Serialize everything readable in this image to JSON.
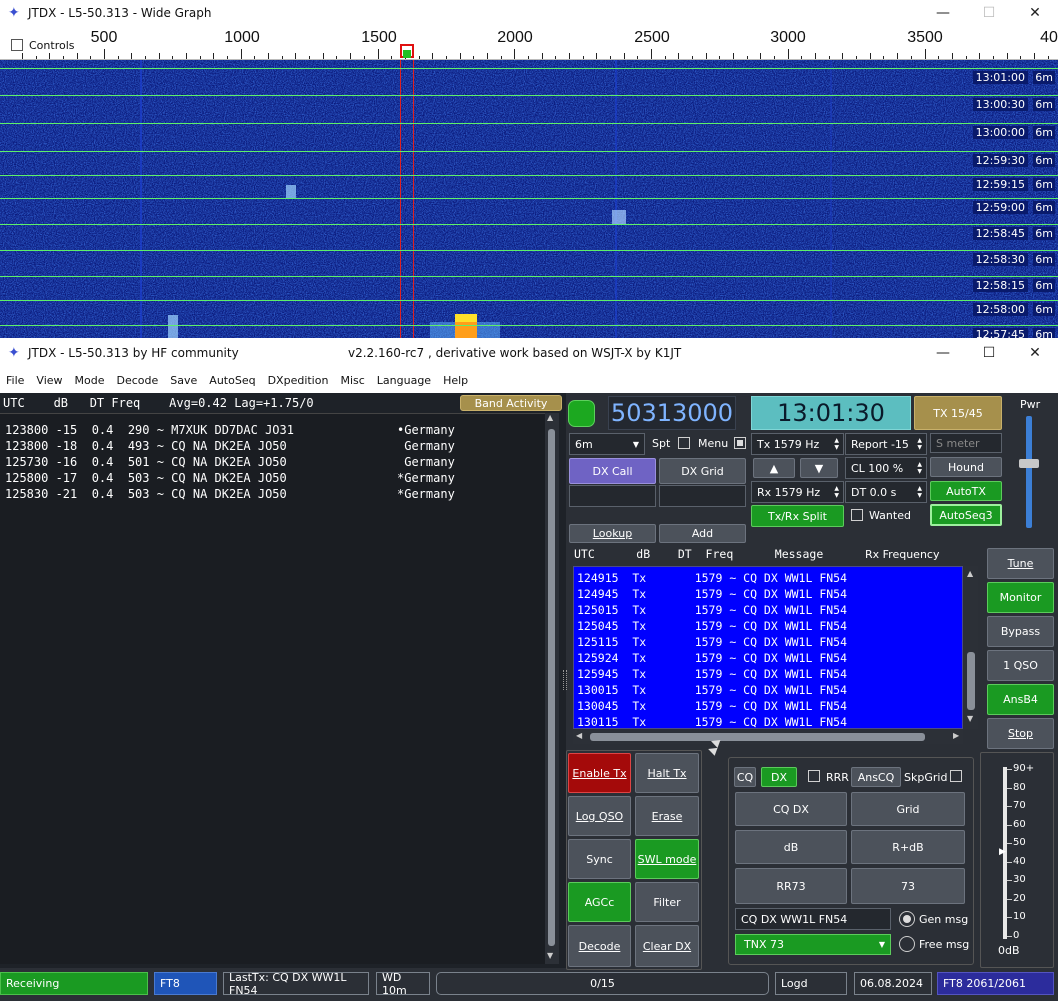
{
  "wide_graph": {
    "title": "JTDX - L5-50.313 - Wide Graph",
    "controls_label": "Controls",
    "scale_labels": [
      "500",
      "1000",
      "1500",
      "2000",
      "2500",
      "3000",
      "3500",
      "40"
    ],
    "time_rows": [
      {
        "time": "13:01:00",
        "band": "6m"
      },
      {
        "time": "13:00:30",
        "band": "6m"
      },
      {
        "time": "13:00:00",
        "band": "6m"
      },
      {
        "time": "12:59:30",
        "band": "6m"
      },
      {
        "time": "12:59:15",
        "band": "6m"
      },
      {
        "time": "12:59:00",
        "band": "6m"
      },
      {
        "time": "12:58:45",
        "band": "6m"
      },
      {
        "time": "12:58:30",
        "band": "6m"
      },
      {
        "time": "12:58:15",
        "band": "6m"
      },
      {
        "time": "12:58:00",
        "band": "6m"
      },
      {
        "time": "12:57:45",
        "band": "6m"
      }
    ]
  },
  "main": {
    "title": "JTDX - L5-50.313  by HF community",
    "title_right": "v2.2.160-rc7 , derivative work based on WSJT-X by K1JT",
    "menu": [
      "File",
      "View",
      "Mode",
      "Decode",
      "Save",
      "AutoSeq",
      "DXpedition",
      "Misc",
      "Language",
      "Help"
    ]
  },
  "band_activity": {
    "header": "UTC    dB   DT Freq    Avg=0.42 Lag=+1.75/0",
    "button": "Band Activity",
    "rows": [
      {
        "text": "123800 -15  0.4  290 ~ M7XUK DD7DAC JO31",
        "country": "•Germany"
      },
      {
        "text": "123800 -18  0.4  493 ~ CQ NA DK2EA JO50",
        "country": " Germany"
      },
      {
        "text": "125730 -16  0.4  501 ~ CQ NA DK2EA JO50",
        "country": " Germany"
      },
      {
        "text": "125800 -17  0.4  503 ~ CQ NA DK2EA JO50",
        "country": "*Germany"
      },
      {
        "text": "125830 -21  0.4  503 ~ CQ NA DK2EA JO50",
        "country": "*Germany"
      }
    ]
  },
  "controls": {
    "frequency": "50313000",
    "clock": "13:01:30",
    "tx_button": "TX 15/45",
    "pwr_label": "Pwr",
    "band": "6m",
    "spt": "Spt",
    "menu": "Menu",
    "tx_hz": "Tx  1579  Hz",
    "report": "Report -15",
    "smeter": "S meter",
    "dx_call": "DX Call",
    "dx_grid": "DX Grid",
    "cl": "CL  100 %",
    "hound": "Hound",
    "rx_hz": "Rx  1579  Hz",
    "dt": "DT  0.0 s",
    "autotx": "AutoTX",
    "txrx_split": "Tx/Rx Split",
    "wanted": "Wanted",
    "autoseq3": "AutoSeq3",
    "lookup": "Lookup",
    "add": "Add"
  },
  "rx_freq": {
    "header": "UTC      dB    DT  Freq      Message",
    "header_right": "Rx Frequency",
    "rows": [
      "124915  Tx       1579 ~ CQ DX WW1L FN54",
      "124945  Tx       1579 ~ CQ DX WW1L FN54",
      "125015  Tx       1579 ~ CQ DX WW1L FN54",
      "125045  Tx       1579 ~ CQ DX WW1L FN54",
      "125115  Tx       1579 ~ CQ DX WW1L FN54",
      "125924  Tx       1579 ~ CQ DX WW1L FN54",
      "125945  Tx       1579 ~ CQ DX WW1L FN54",
      "130015  Tx       1579 ~ CQ DX WW1L FN54",
      "130045  Tx       1579 ~ CQ DX WW1L FN54",
      "130115  Tx       1579 ~ CQ DX WW1L FN54"
    ]
  },
  "side_buttons": [
    "Tune",
    "Monitor",
    "Bypass",
    "1 QSO",
    "AnsB4",
    "Stop"
  ],
  "left_buttons": [
    "Enable Tx",
    "Halt Tx",
    "Log QSO",
    "Erase",
    "Sync",
    "SWL mode",
    "AGCc",
    "Filter",
    "Decode",
    "Clear DX"
  ],
  "msg_panel": {
    "cq": "CQ",
    "dx": "DX",
    "rrr": "RRR",
    "anscq": "AnsCQ",
    "skpgrid": "SkpGrid",
    "buttons": [
      "CQ DX",
      "Grid",
      "dB",
      "R+dB",
      "RR73",
      "73"
    ],
    "gen_text": "CQ DX WW1L FN54",
    "gen_label": "Gen msg",
    "free_text": "TNX 73",
    "free_label": "Free msg"
  },
  "meter": {
    "labels": [
      "90+",
      "80",
      "70",
      "60",
      "50",
      "40",
      "30",
      "20",
      "10",
      "0"
    ],
    "unit": "0dB"
  },
  "statusbar": {
    "receiving": "Receiving",
    "mode": "FT8",
    "lasttx": "LastTx: CQ DX WW1L FN54",
    "wd": "WD 10m",
    "progress": "0/15",
    "logd": "Logd",
    "date": "06.08.2024",
    "ft8count": "FT8  2061/2061"
  }
}
